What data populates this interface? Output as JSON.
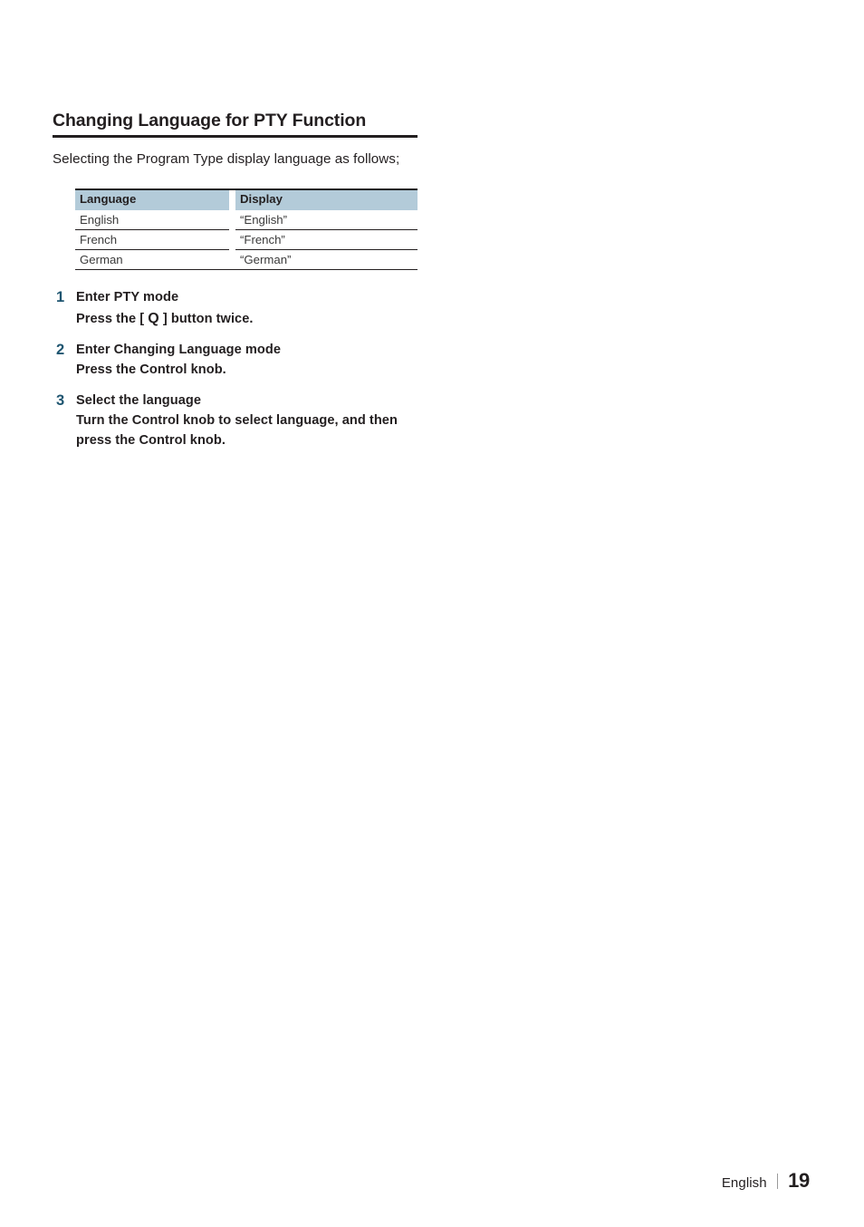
{
  "document": {
    "section_heading": "Changing Language for PTY Function",
    "intro": "Selecting the Program Type display language as follows;"
  },
  "table": {
    "headers": [
      "Language",
      "Display"
    ],
    "rows": [
      {
        "language": "English",
        "display": "“English”"
      },
      {
        "language": "French",
        "display": "“French”"
      },
      {
        "language": "German",
        "display": "“German”"
      }
    ]
  },
  "steps": [
    {
      "number": "1",
      "title": "Enter PTY mode",
      "body_before": "Press the [ ",
      "button_glyph": "Q",
      "body_after": " ] button twice."
    },
    {
      "number": "2",
      "title": "Enter Changing Language mode",
      "body": "Press the Control knob."
    },
    {
      "number": "3",
      "title": "Select the language",
      "body": "Turn the Control knob to select language, and then press the Control knob."
    }
  ],
  "footer": {
    "language": "English",
    "page_number": "19"
  },
  "colors": {
    "text": "#231f20",
    "step_number": "#1e5570",
    "table_header_fill": "#b3cbd9",
    "table_body_text": "#3a3a3a",
    "rule": "#231f20",
    "footer_separator": "#9a9a9a"
  }
}
